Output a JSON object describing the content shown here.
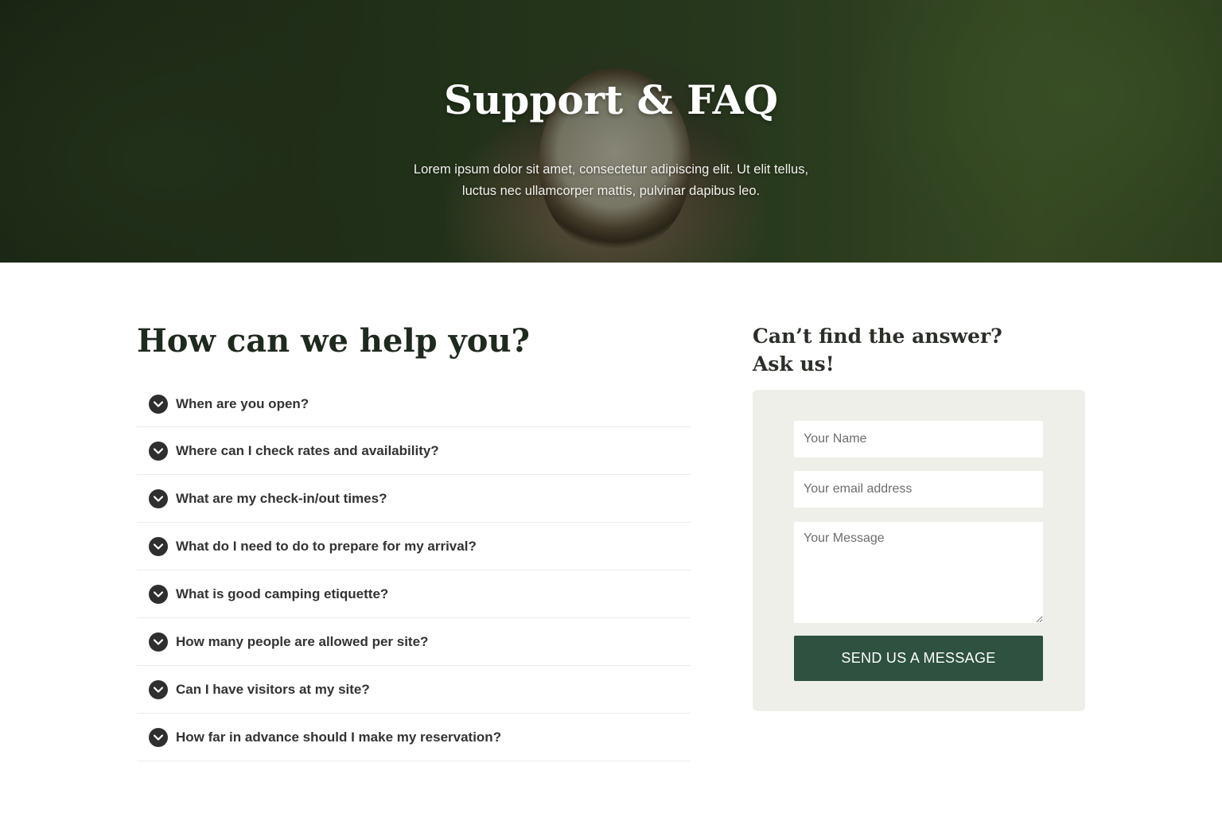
{
  "hero": {
    "title": "Support & FAQ",
    "subtitle": "Lorem ipsum dolor sit amet, consectetur adipiscing elit. Ut elit tellus, luctus nec ullamcorper mattis, pulvinar dapibus leo."
  },
  "faq": {
    "heading": "How can we help you?",
    "items": [
      {
        "question": "When are you open?"
      },
      {
        "question": "Where can I check rates and availability?"
      },
      {
        "question": "What are my check-in/out times?"
      },
      {
        "question": "What do I need to do to prepare for my arrival?"
      },
      {
        "question": "What is good camping etiquette?"
      },
      {
        "question": "How many people are allowed per site?"
      },
      {
        "question": "Can I have visitors at my site?"
      },
      {
        "question": "How far in advance should I make my reservation?"
      }
    ],
    "icon": "chevron-down-circle-icon"
  },
  "contact": {
    "heading_line1": "Can’t find the answer?",
    "heading_line2": "Ask us!",
    "name_placeholder": "Your Name",
    "email_placeholder": "Your email address",
    "message_placeholder": "Your Message",
    "submit_label": "SEND US A MESSAGE"
  },
  "colors": {
    "accent": "#2e5140",
    "card_bg": "#efefea",
    "heading": "#1f2a1e"
  }
}
